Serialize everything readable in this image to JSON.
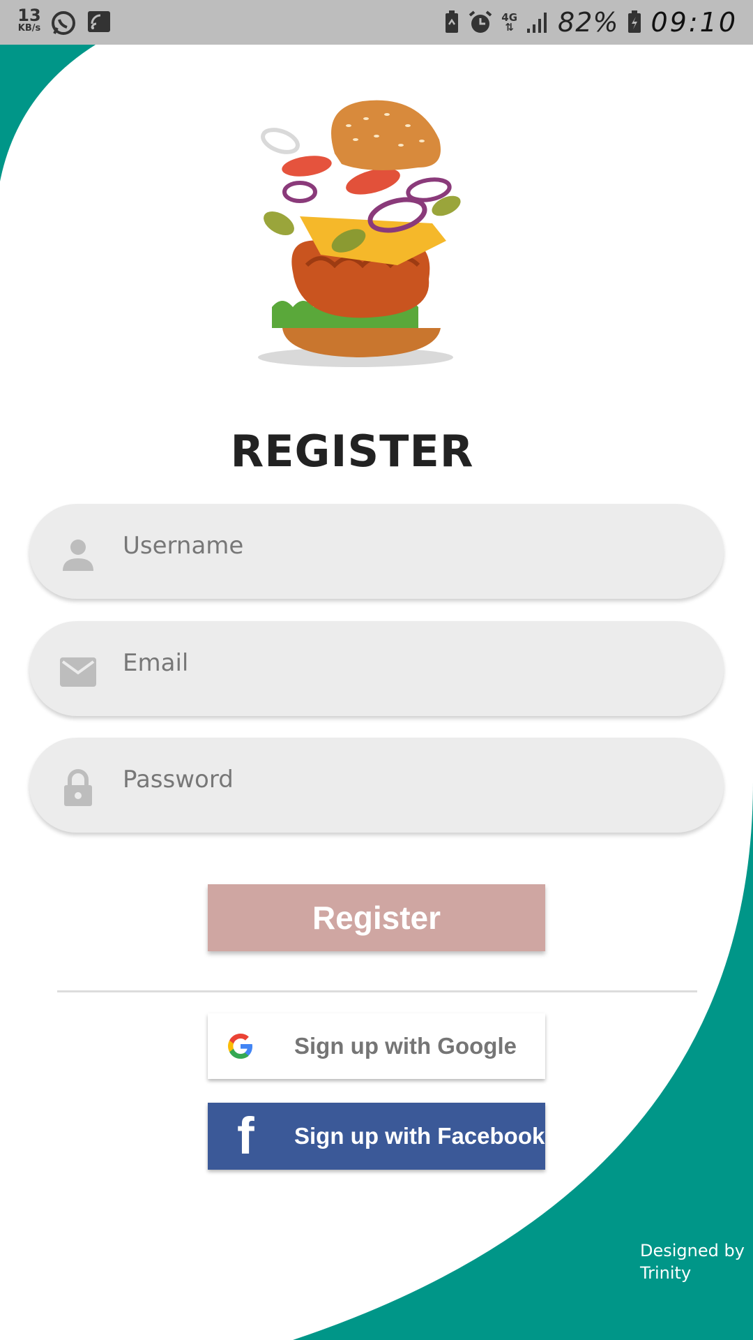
{
  "status_bar": {
    "speed_value": "13",
    "speed_unit": "KB/s",
    "battery_percent": "82%",
    "time": "09:10",
    "network_label": "4G",
    "icons": [
      "whatsapp-icon",
      "cast-icon",
      "battery-saver-icon",
      "alarm-icon",
      "network-4g-icon",
      "signal-icon",
      "battery-charging-icon"
    ]
  },
  "colors": {
    "accent_teal": "#009688",
    "register_button": "#cfa6a2",
    "facebook_blue": "#3b5998",
    "field_background": "#ececec"
  },
  "logo": {
    "icon": "burger-logo"
  },
  "form": {
    "title": "REGISTER",
    "username_placeholder": "Username",
    "email_placeholder": "Email",
    "password_placeholder": "Password",
    "register_label": "Register"
  },
  "social": {
    "google_label": "Sign up with Google",
    "facebook_label": "Sign up with Facebook"
  },
  "footer": {
    "credit_line1": "Designed by",
    "credit_line2": "Trinity"
  }
}
